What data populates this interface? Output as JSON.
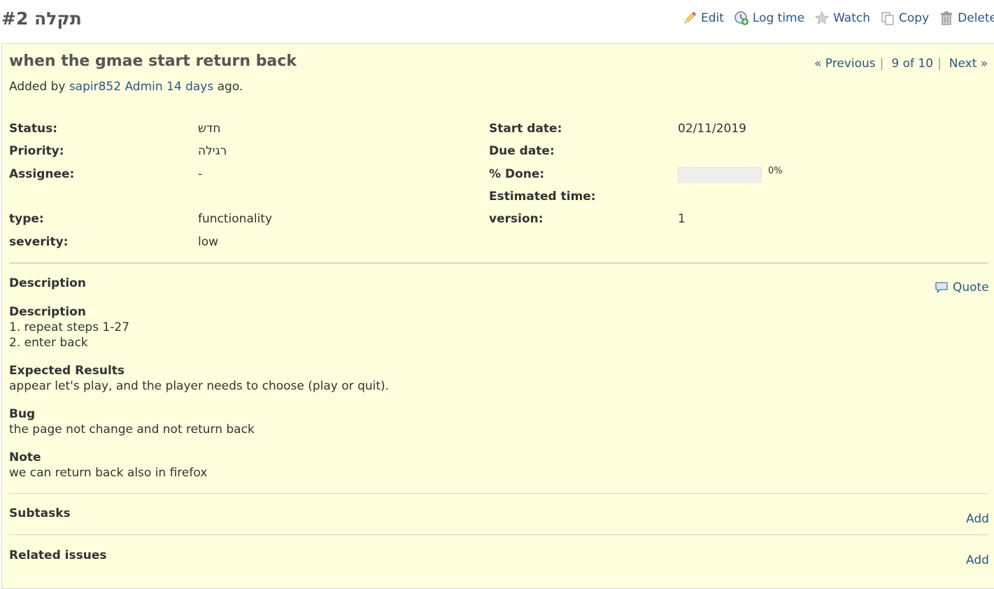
{
  "header": {
    "title": "תקלה #2",
    "actions": [
      {
        "label": "Edit",
        "icon": "pencil-icon"
      },
      {
        "label": "Log time",
        "icon": "clock-add-icon"
      },
      {
        "label": "Watch",
        "icon": "star-icon"
      },
      {
        "label": "Copy",
        "icon": "copy-icon"
      },
      {
        "label": "Delete",
        "icon": "trash-icon"
      }
    ]
  },
  "issue": {
    "subject": "when the gmae start return back",
    "added_by_prefix": "Added by",
    "author": "sapir852 Admin",
    "age": "14 days",
    "age_suffix": "ago.",
    "nav": {
      "previous": "« Previous",
      "position": "9 of 10",
      "next": "Next »",
      "separator": "|"
    },
    "attributes": {
      "status": {
        "label": "Status:",
        "value": "חדש"
      },
      "priority": {
        "label": "Priority:",
        "value": "רגילה"
      },
      "assignee": {
        "label": "Assignee:",
        "value": "-"
      },
      "type": {
        "label": "type:",
        "value": "functionality"
      },
      "severity": {
        "label": "severity:",
        "value": "low"
      },
      "start_date": {
        "label": "Start date:",
        "value": "02/11/2019"
      },
      "due_date": {
        "label": "Due date:",
        "value": ""
      },
      "done": {
        "label": "% Done:",
        "value": "0%",
        "ratio": 0
      },
      "estimated": {
        "label": "Estimated time:",
        "value": ""
      },
      "version": {
        "label": "version:",
        "value": "1"
      }
    },
    "description": {
      "title": "Description",
      "quote": "Quote",
      "blocks": [
        {
          "heading": "Description",
          "lines": [
            "1. repeat steps 1-27",
            "2. enter back"
          ]
        },
        {
          "heading": "Expected Results",
          "lines": [
            "appear let's play, and the player needs to choose (play or quit)."
          ]
        },
        {
          "heading": "Bug",
          "lines": [
            "the page not change and not return back"
          ]
        },
        {
          "heading": "Note",
          "lines": [
            "we can return back also in firefox"
          ]
        }
      ]
    },
    "subtasks": {
      "title": "Subtasks",
      "add": "Add"
    },
    "related": {
      "title": "Related issues",
      "add": "Add"
    }
  },
  "colors": {
    "link": "#2a5685",
    "box_background": "#ffffdd",
    "heading": "#555555",
    "progress_empty": "#eeeeee"
  }
}
